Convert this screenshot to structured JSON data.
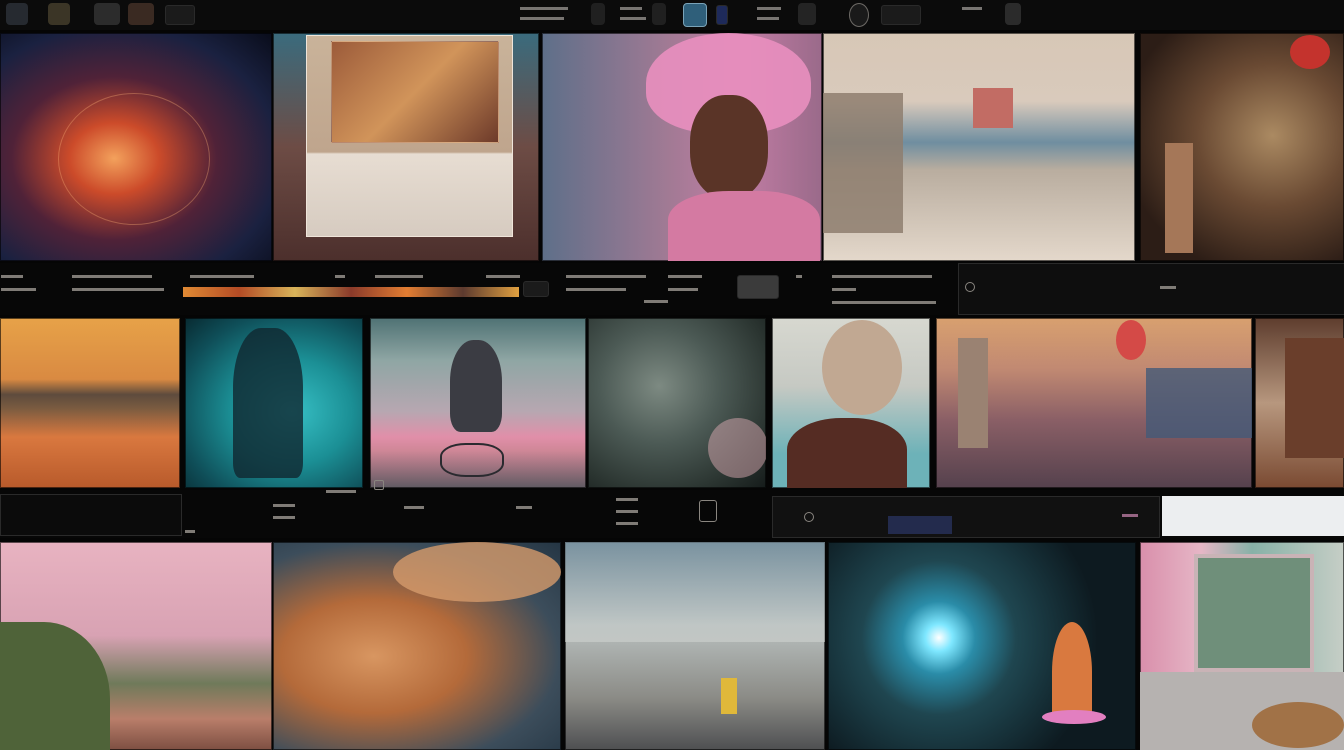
{
  "photos": [
    "explosion-sparks-photo",
    "museum-display-case-photo",
    "woman-pink-hat-photo",
    "snowy-village-photo",
    "autumn-plants-photo",
    "sunset-lake-photo",
    "underwater-tree-photo",
    "bicycle-figure-photo",
    "blurred-foliage-photo",
    "old-woman-back-photo",
    "industrial-town-photo",
    "interior-shelves-photo",
    "pink-fog-forest-photo",
    "orange-clouds-photo",
    "graffiti-wall-street-photo",
    "flower-light-burst-photo",
    "window-room-photo"
  ],
  "colors": {
    "background": "#050505",
    "band": "#070707",
    "ui_gray": "#1b1b1b"
  }
}
